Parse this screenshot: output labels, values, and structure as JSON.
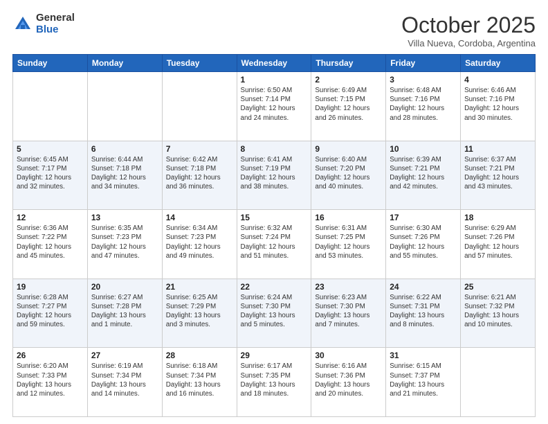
{
  "header": {
    "logo_general": "General",
    "logo_blue": "Blue",
    "month_title": "October 2025",
    "subtitle": "Villa Nueva, Cordoba, Argentina"
  },
  "weekdays": [
    "Sunday",
    "Monday",
    "Tuesday",
    "Wednesday",
    "Thursday",
    "Friday",
    "Saturday"
  ],
  "weeks": [
    [
      {
        "day": "",
        "info": ""
      },
      {
        "day": "",
        "info": ""
      },
      {
        "day": "",
        "info": ""
      },
      {
        "day": "1",
        "info": "Sunrise: 6:50 AM\nSunset: 7:14 PM\nDaylight: 12 hours\nand 24 minutes."
      },
      {
        "day": "2",
        "info": "Sunrise: 6:49 AM\nSunset: 7:15 PM\nDaylight: 12 hours\nand 26 minutes."
      },
      {
        "day": "3",
        "info": "Sunrise: 6:48 AM\nSunset: 7:16 PM\nDaylight: 12 hours\nand 28 minutes."
      },
      {
        "day": "4",
        "info": "Sunrise: 6:46 AM\nSunset: 7:16 PM\nDaylight: 12 hours\nand 30 minutes."
      }
    ],
    [
      {
        "day": "5",
        "info": "Sunrise: 6:45 AM\nSunset: 7:17 PM\nDaylight: 12 hours\nand 32 minutes."
      },
      {
        "day": "6",
        "info": "Sunrise: 6:44 AM\nSunset: 7:18 PM\nDaylight: 12 hours\nand 34 minutes."
      },
      {
        "day": "7",
        "info": "Sunrise: 6:42 AM\nSunset: 7:18 PM\nDaylight: 12 hours\nand 36 minutes."
      },
      {
        "day": "8",
        "info": "Sunrise: 6:41 AM\nSunset: 7:19 PM\nDaylight: 12 hours\nand 38 minutes."
      },
      {
        "day": "9",
        "info": "Sunrise: 6:40 AM\nSunset: 7:20 PM\nDaylight: 12 hours\nand 40 minutes."
      },
      {
        "day": "10",
        "info": "Sunrise: 6:39 AM\nSunset: 7:21 PM\nDaylight: 12 hours\nand 42 minutes."
      },
      {
        "day": "11",
        "info": "Sunrise: 6:37 AM\nSunset: 7:21 PM\nDaylight: 12 hours\nand 43 minutes."
      }
    ],
    [
      {
        "day": "12",
        "info": "Sunrise: 6:36 AM\nSunset: 7:22 PM\nDaylight: 12 hours\nand 45 minutes."
      },
      {
        "day": "13",
        "info": "Sunrise: 6:35 AM\nSunset: 7:23 PM\nDaylight: 12 hours\nand 47 minutes."
      },
      {
        "day": "14",
        "info": "Sunrise: 6:34 AM\nSunset: 7:23 PM\nDaylight: 12 hours\nand 49 minutes."
      },
      {
        "day": "15",
        "info": "Sunrise: 6:32 AM\nSunset: 7:24 PM\nDaylight: 12 hours\nand 51 minutes."
      },
      {
        "day": "16",
        "info": "Sunrise: 6:31 AM\nSunset: 7:25 PM\nDaylight: 12 hours\nand 53 minutes."
      },
      {
        "day": "17",
        "info": "Sunrise: 6:30 AM\nSunset: 7:26 PM\nDaylight: 12 hours\nand 55 minutes."
      },
      {
        "day": "18",
        "info": "Sunrise: 6:29 AM\nSunset: 7:26 PM\nDaylight: 12 hours\nand 57 minutes."
      }
    ],
    [
      {
        "day": "19",
        "info": "Sunrise: 6:28 AM\nSunset: 7:27 PM\nDaylight: 12 hours\nand 59 minutes."
      },
      {
        "day": "20",
        "info": "Sunrise: 6:27 AM\nSunset: 7:28 PM\nDaylight: 13 hours\nand 1 minute."
      },
      {
        "day": "21",
        "info": "Sunrise: 6:25 AM\nSunset: 7:29 PM\nDaylight: 13 hours\nand 3 minutes."
      },
      {
        "day": "22",
        "info": "Sunrise: 6:24 AM\nSunset: 7:30 PM\nDaylight: 13 hours\nand 5 minutes."
      },
      {
        "day": "23",
        "info": "Sunrise: 6:23 AM\nSunset: 7:30 PM\nDaylight: 13 hours\nand 7 minutes."
      },
      {
        "day": "24",
        "info": "Sunrise: 6:22 AM\nSunset: 7:31 PM\nDaylight: 13 hours\nand 8 minutes."
      },
      {
        "day": "25",
        "info": "Sunrise: 6:21 AM\nSunset: 7:32 PM\nDaylight: 13 hours\nand 10 minutes."
      }
    ],
    [
      {
        "day": "26",
        "info": "Sunrise: 6:20 AM\nSunset: 7:33 PM\nDaylight: 13 hours\nand 12 minutes."
      },
      {
        "day": "27",
        "info": "Sunrise: 6:19 AM\nSunset: 7:34 PM\nDaylight: 13 hours\nand 14 minutes."
      },
      {
        "day": "28",
        "info": "Sunrise: 6:18 AM\nSunset: 7:34 PM\nDaylight: 13 hours\nand 16 minutes."
      },
      {
        "day": "29",
        "info": "Sunrise: 6:17 AM\nSunset: 7:35 PM\nDaylight: 13 hours\nand 18 minutes."
      },
      {
        "day": "30",
        "info": "Sunrise: 6:16 AM\nSunset: 7:36 PM\nDaylight: 13 hours\nand 20 minutes."
      },
      {
        "day": "31",
        "info": "Sunrise: 6:15 AM\nSunset: 7:37 PM\nDaylight: 13 hours\nand 21 minutes."
      },
      {
        "day": "",
        "info": ""
      }
    ]
  ]
}
